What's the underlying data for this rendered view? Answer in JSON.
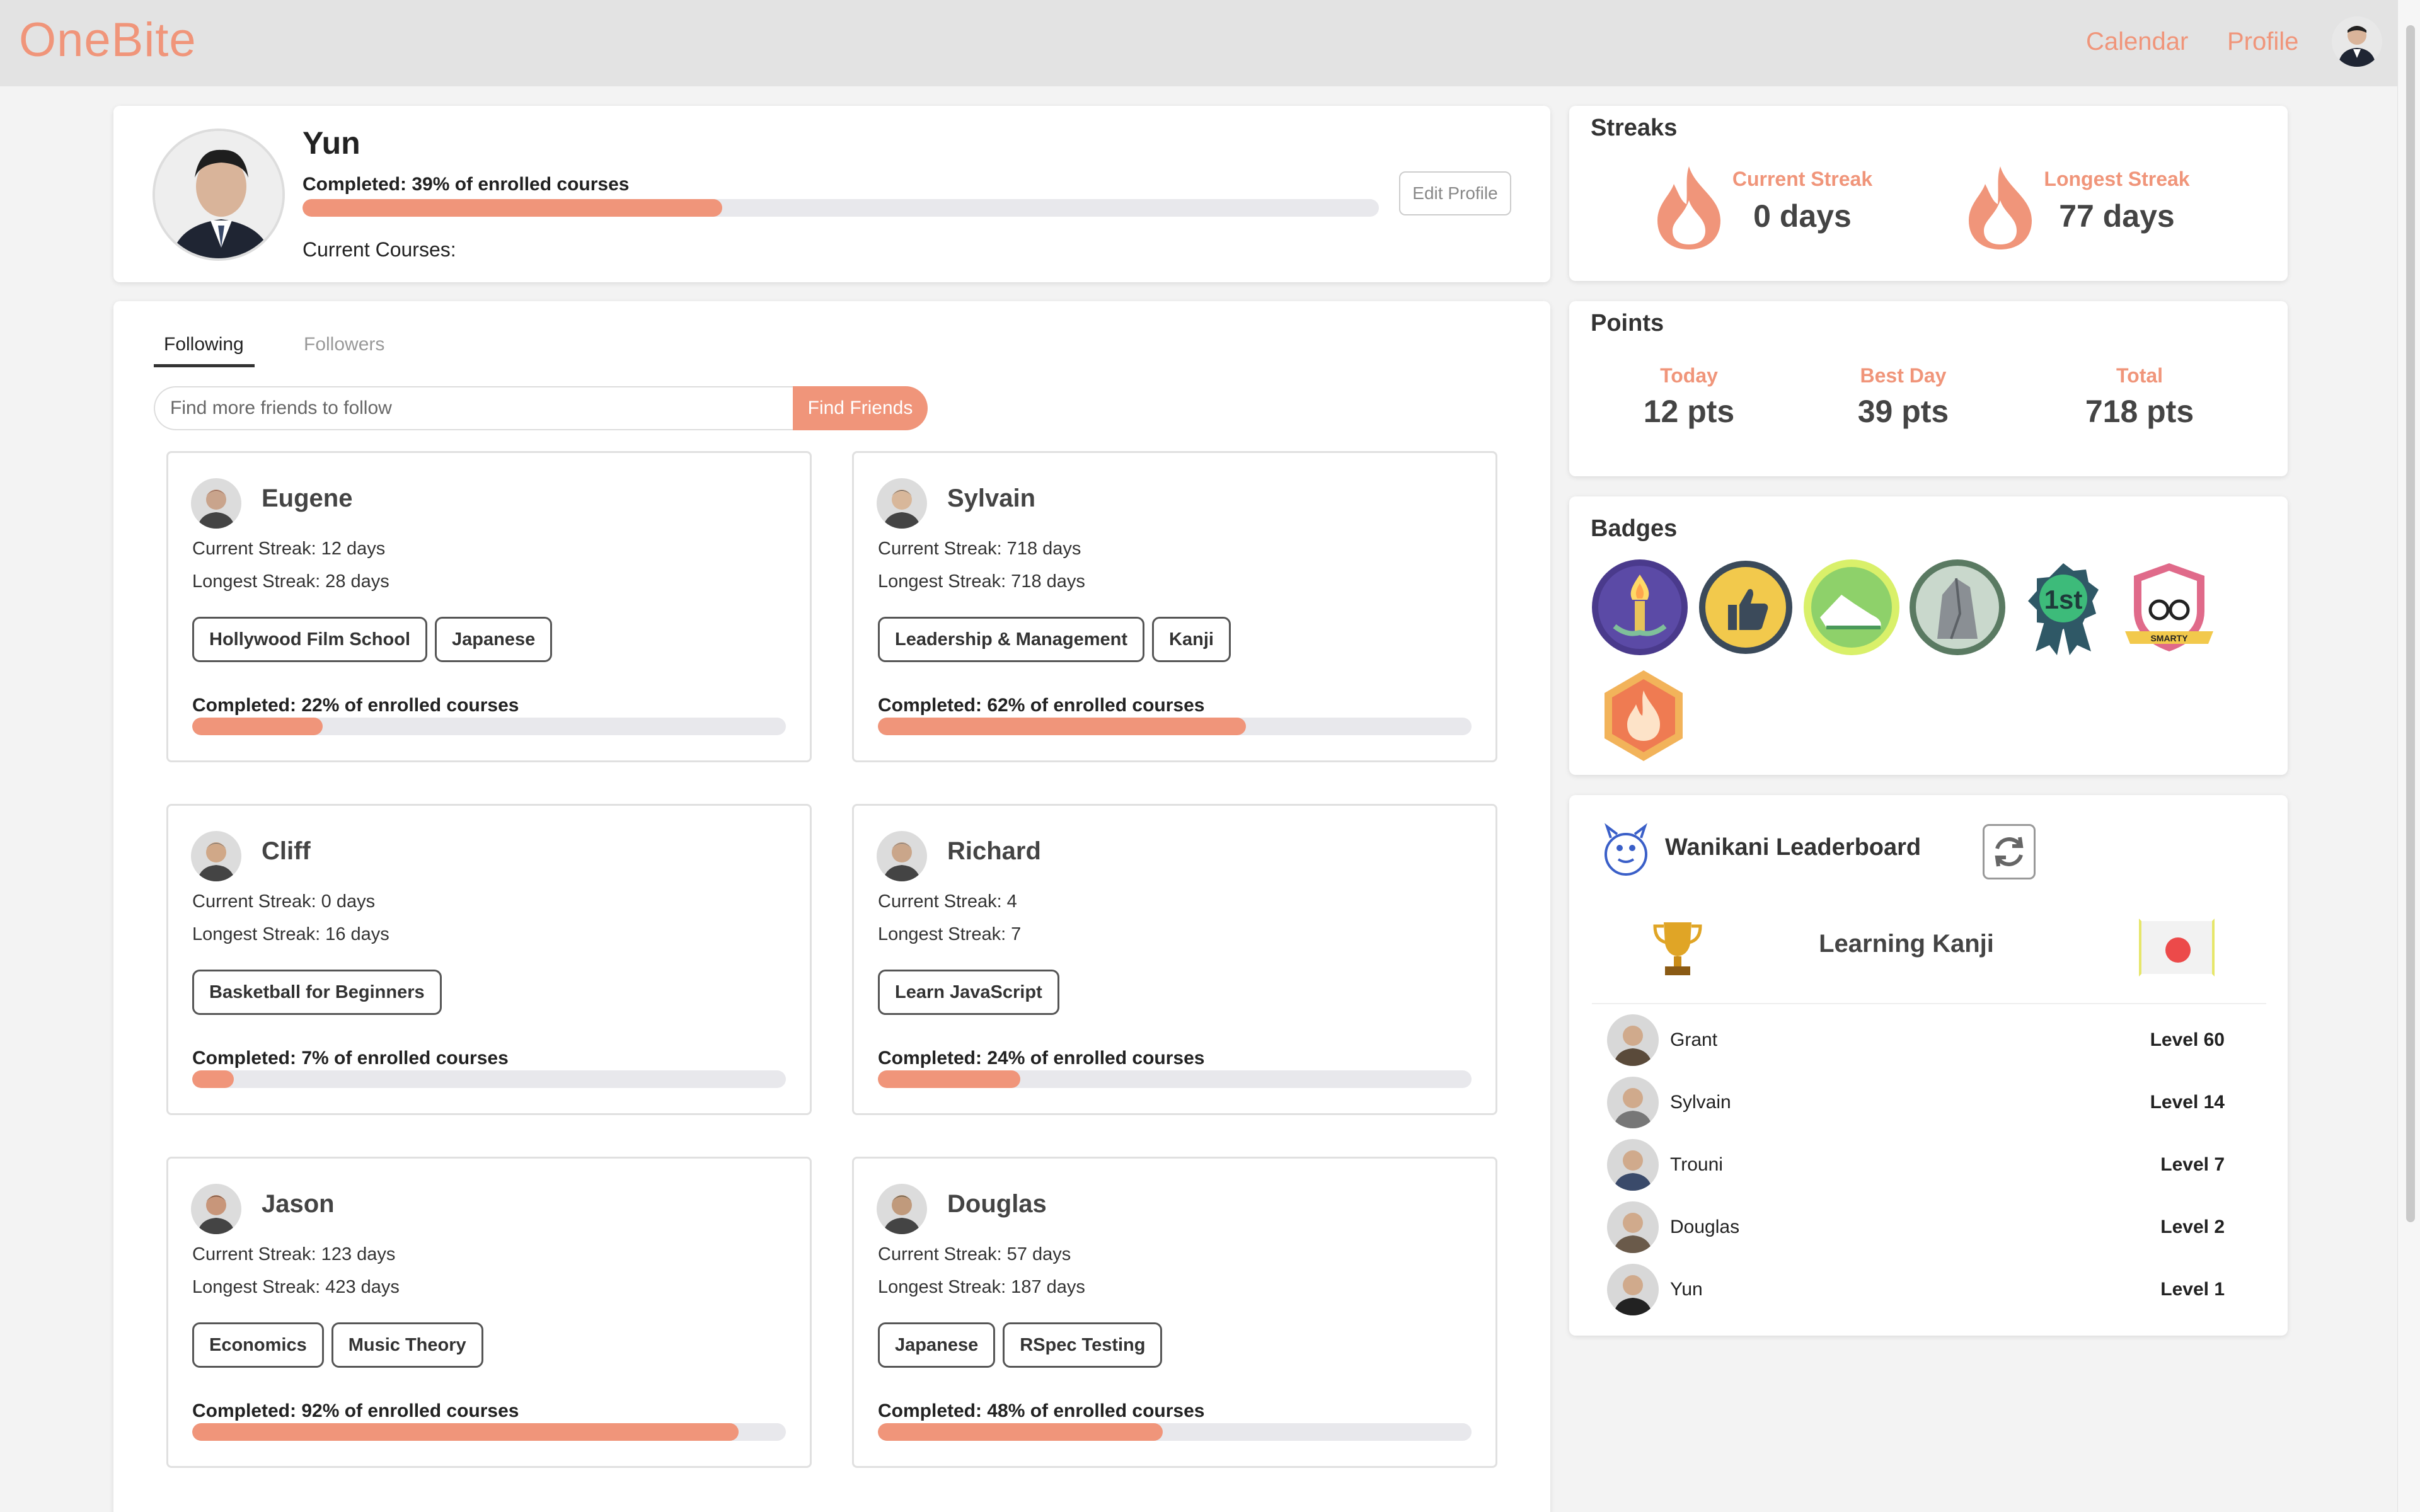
{
  "nav": {
    "brand": "OneBite",
    "calendar": "Calendar",
    "profile": "Profile"
  },
  "profile": {
    "name": "Yun",
    "completed_text": "Completed: 39% of enrolled courses",
    "completed_percent": 39,
    "current_courses_label": "Current Courses:",
    "edit_button": "Edit Profile"
  },
  "social": {
    "tabs": [
      {
        "label": "Following",
        "active": true
      },
      {
        "label": "Followers",
        "active": false
      }
    ],
    "search_placeholder": "Find more friends to follow",
    "find_button": "Find Friends",
    "friends": [
      {
        "name": "Eugene",
        "current": "Current Streak: 12 days",
        "longest": "Longest Streak: 28 days",
        "tags": [
          "Hollywood Film School",
          "Japanese"
        ],
        "completed": "Completed: 22% of enrolled courses",
        "percent": 22
      },
      {
        "name": "Sylvain",
        "current": "Current Streak: 718 days",
        "longest": "Longest Streak: 718 days",
        "tags": [
          "Leadership & Management",
          "Kanji"
        ],
        "completed": "Completed: 62% of enrolled courses",
        "percent": 62
      },
      {
        "name": "Cliff",
        "current": "Current Streak: 0 days",
        "longest": "Longest Streak: 16 days",
        "tags": [
          "Basketball for Beginners"
        ],
        "completed": "Completed: 7% of enrolled courses",
        "percent": 7
      },
      {
        "name": "Richard",
        "current": "Current Streak: 4",
        "longest": "Longest Streak: 7",
        "tags": [
          "Learn JavaScript"
        ],
        "completed": "Completed: 24% of enrolled courses",
        "percent": 24
      },
      {
        "name": "Jason",
        "current": "Current Streak: 123 days",
        "longest": "Longest Streak: 423 days",
        "tags": [
          "Economics",
          "Music Theory"
        ],
        "completed": "Completed: 92% of enrolled courses",
        "percent": 92
      },
      {
        "name": "Douglas",
        "current": "Current Streak: 57 days",
        "longest": "Longest Streak: 187 days",
        "tags": [
          "Japanese",
          "RSpec Testing"
        ],
        "completed": "Completed: 48% of enrolled courses",
        "percent": 48
      }
    ]
  },
  "streaks": {
    "title": "Streaks",
    "current_label": "Current Streak",
    "current_value": "0 days",
    "longest_label": "Longest Streak",
    "longest_value": "77 days"
  },
  "points": {
    "title": "Points",
    "today_label": "Today",
    "today_value": "12 pts",
    "best_label": "Best Day",
    "best_value": "39 pts",
    "total_label": "Total",
    "total_value": "718 pts"
  },
  "badges": {
    "title": "Badges",
    "items": [
      "torch-badge",
      "thumbs-up-badge",
      "shoe-badge",
      "rock-badge",
      "first-place-ribbon-badge",
      "smarty-glasses-badge",
      "flame-hexagon-badge"
    ],
    "smarty_text": "SMARTY",
    "first_text": "1st"
  },
  "leaderboard": {
    "title": "Wanikani Leaderboard",
    "subtitle": "Learning Kanji",
    "rows": [
      {
        "name": "Grant",
        "level": "Level 60"
      },
      {
        "name": "Sylvain",
        "level": "Level 14"
      },
      {
        "name": "Trouni",
        "level": "Level 7"
      },
      {
        "name": "Douglas",
        "level": "Level 2"
      },
      {
        "name": "Yun",
        "level": "Level 1"
      }
    ]
  },
  "colors": {
    "accent": "#f0957a",
    "track": "#e8e8ec"
  }
}
